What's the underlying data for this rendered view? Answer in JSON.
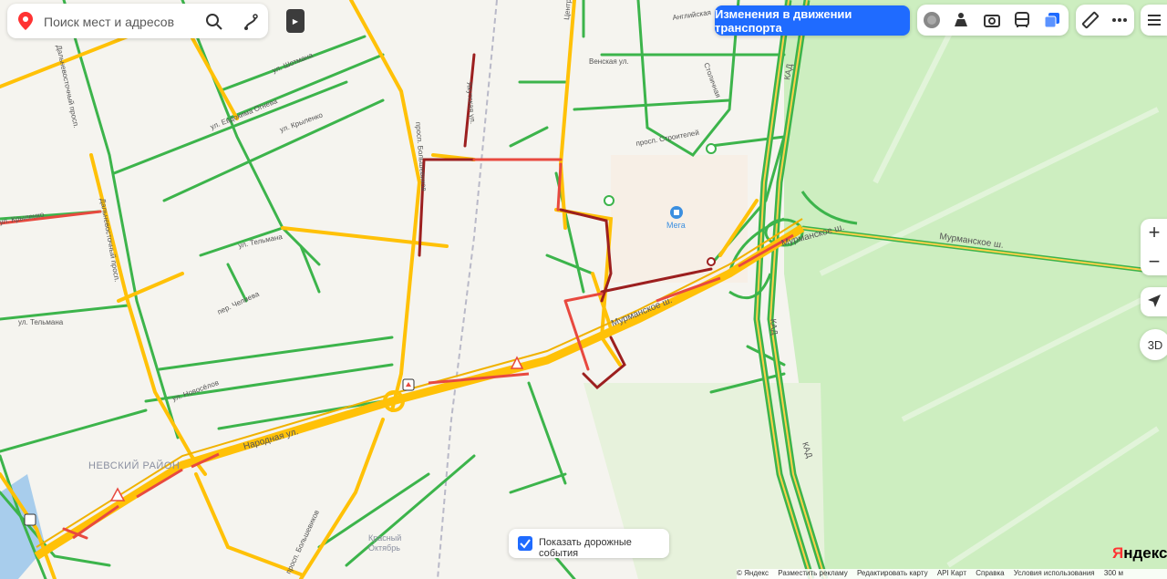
{
  "search": {
    "placeholder": "Поиск мест и адресов"
  },
  "traffic_changes_button": "Изменения в движении транспорта",
  "show_events": {
    "label": "Показать дорожные события",
    "checked": true
  },
  "map_labels": {
    "nevsky_district": "НЕВСКИЙ РАЙОН",
    "narodnaya": "Народная ул.",
    "murmanskoe_1": "Мурманское ш.",
    "murmanskoe_2": "Мурманское ш.",
    "murmanskoe_3": "Мурманское ш.",
    "kad_1": "КАД",
    "kad_2": "КАД",
    "kad_3": "КАД",
    "mega": "Мега",
    "dalnevostochny_1": "Дальневосточный просп.",
    "dalnevostochny_2": "Дальневосточный просп.",
    "bolshevikov_1": "просп. Большевиков",
    "bolshevikov_2": "просп. Большевиков",
    "krylenko_1": "ул. Крыленко",
    "krylenko_2": "ул. Крыленко",
    "shotmana": "ул. Шотмана",
    "evdokimova": "ул. Евдокима Огнева",
    "telmana_1": "ул. Тельмана",
    "telmana_2": "ул. Тельмана",
    "chelieva": "пер. Челиева",
    "novoselov": "ул. Новосёлов",
    "yakutskaya": "Якутская ул.",
    "venskaya": "Венская ул.",
    "angliyskaya": "Английская",
    "stroiteley": "просп. Строителей",
    "stoliychnaya": "Столичная",
    "centralnaya": "Центральная",
    "krasny_oktyabr_1": "Красный",
    "krasny_oktyabr_2": "Октябрь"
  },
  "footer": {
    "copyright": "© Яндекс",
    "ads": "Разместить рекламу",
    "edit": "Редактировать карту",
    "api": "API Карт",
    "help": "Справка",
    "terms": "Условия использования",
    "scale": "300 м"
  },
  "logo": {
    "first": "Я",
    "rest": "ндекс"
  },
  "zoom": {
    "in": "+",
    "out": "−"
  },
  "btn_3d": "3D",
  "icons": [
    "location-pin-icon",
    "search-icon",
    "route-icon",
    "collapse-arrow-icon",
    "traffic-light-icon",
    "panorama-icon",
    "camera-icon",
    "bus-icon",
    "layers-icon",
    "ruler-icon",
    "more-icon",
    "menu-icon",
    "locate-arrow-icon",
    "zoom-in-icon",
    "zoom-out-icon",
    "checkbox-icon",
    "road-event-icon",
    "shopping-bag-icon"
  ],
  "colors": {
    "traffic_free": "#3cb44b",
    "traffic_medium": "#ffc107",
    "traffic_heavy": "#e8493f",
    "traffic_jam": "#9c1f1f",
    "accent": "#1f6bff",
    "forest": "#cdeec0",
    "background": "#f5f4ef"
  }
}
